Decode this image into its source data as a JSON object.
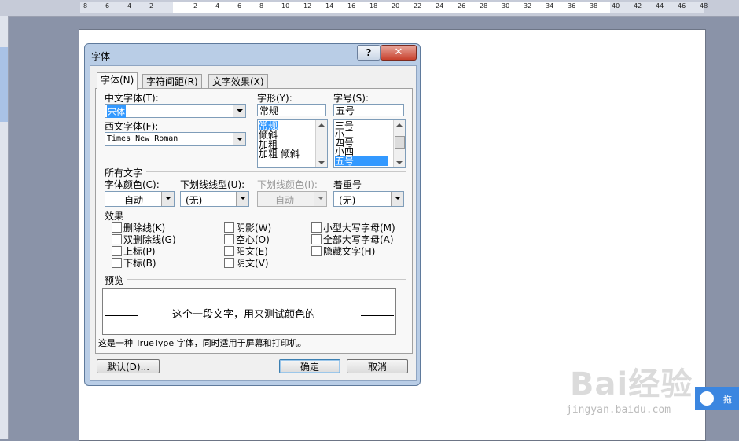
{
  "ruler": {
    "ticks": [
      "8",
      "6",
      "4",
      "2",
      "2",
      "4",
      "6",
      "8",
      "10",
      "12",
      "14",
      "16",
      "18",
      "20",
      "22",
      "24",
      "26",
      "28",
      "30",
      "32",
      "34",
      "36",
      "38",
      "40",
      "42",
      "44",
      "46",
      "48"
    ]
  },
  "dialog": {
    "title": "字体",
    "help_label": "?",
    "close_label": "✕",
    "tabs": [
      "字体(N)",
      "字符间距(R)",
      "文字效果(X)"
    ],
    "chinese_font": {
      "label": "中文字体(T):",
      "value": "宋体"
    },
    "western_font": {
      "label": "西文字体(F):",
      "value": "Times New Roman"
    },
    "style": {
      "label": "字形(Y):",
      "value": "常规",
      "items": [
        "常规",
        "倾斜",
        "加粗",
        "加粗 倾斜"
      ],
      "selected_index": 0
    },
    "size": {
      "label": "字号(S):",
      "value": "五号",
      "items": [
        "三号",
        "小三",
        "四号",
        "小四",
        "五号"
      ],
      "selected_index": 4
    },
    "all_text": {
      "heading": "所有文字",
      "font_color": {
        "label": "字体颜色(C):",
        "value": "自动"
      },
      "underline_style": {
        "label": "下划线线型(U):",
        "value": "(无)"
      },
      "underline_color": {
        "label": "下划线颜色(I):",
        "value": "自动"
      },
      "emphasis": {
        "label": "着重号",
        "value": "(无)"
      }
    },
    "effects": {
      "heading": "效果",
      "col1": [
        "删除线(K)",
        "双删除线(G)",
        "上标(P)",
        "下标(B)"
      ],
      "col2": [
        "阴影(W)",
        "空心(O)",
        "阳文(E)",
        "阴文(V)"
      ],
      "col3": [
        "小型大写字母(M)",
        "全部大写字母(A)",
        "隐藏文字(H)"
      ]
    },
    "preview": {
      "heading": "预览",
      "text": "这个一段文字，用来测试颜色的"
    },
    "info": "这是一种 TrueType 字体，同时适用于屏幕和打印机。",
    "default_button": "默认(D)...",
    "ok_button": "确定",
    "cancel_button": "取消"
  },
  "watermark": {
    "logo": "Bai经验",
    "url": "jingyan.baidu.com"
  },
  "side_button": {
    "label": "拖"
  }
}
